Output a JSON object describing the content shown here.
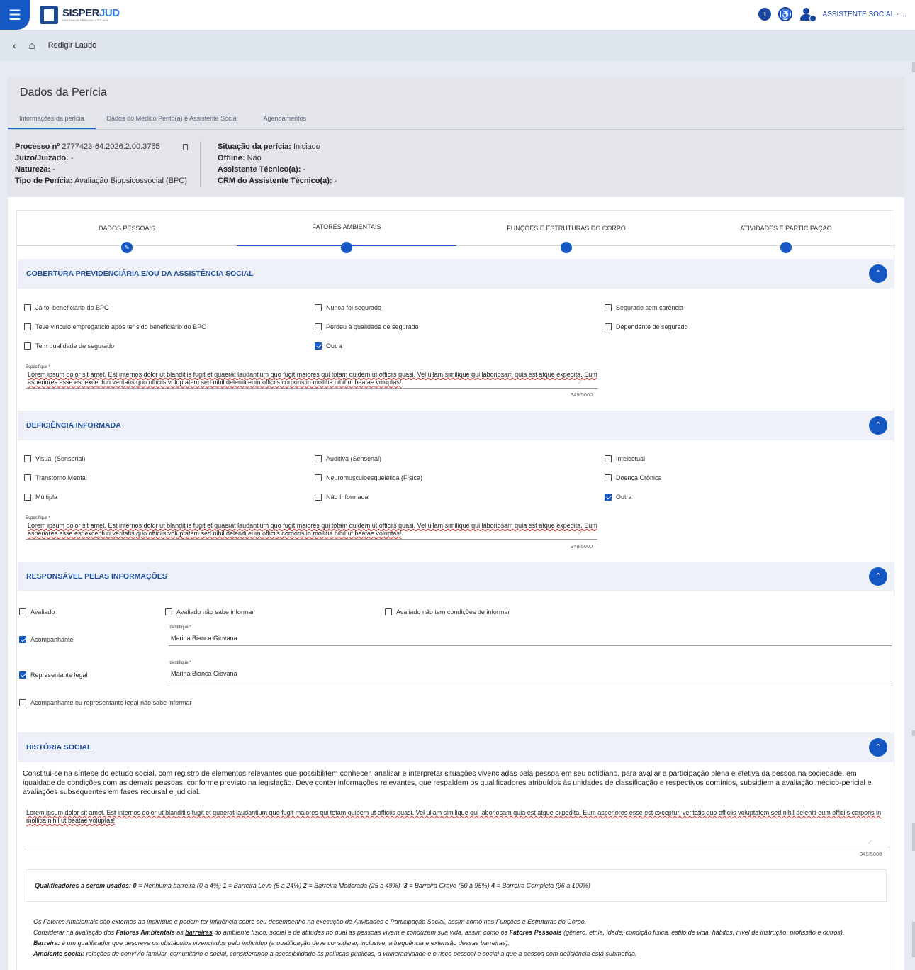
{
  "topbar": {
    "logo_main": "SISPER",
    "logo_accent": "JUD",
    "logo_sub": "SISTEMA DE PERÍCIAS JUDICIAIS",
    "user_name": "ASSISTENTE SOCIAL - ..."
  },
  "breadcrumb": {
    "current": "Redigir Laudo"
  },
  "card": {
    "title": "Dados da Perícia",
    "tabs": [
      "Informações da perícia",
      "Dados do Médico Perito(a) e Assistente Social",
      "Agendamentos"
    ],
    "info_left": [
      {
        "label": "Processo nº",
        "value": "2777423-64.2026.2.00.3755"
      },
      {
        "label": "Juízo/Juizado:",
        "value": "-"
      },
      {
        "label": "Natureza:",
        "value": "-"
      },
      {
        "label": "Tipo de Perícia:",
        "value": "Avaliação Biopsicossocial (BPC)"
      }
    ],
    "info_right": [
      {
        "label": "Situação da perícia:",
        "value": "Iniciado"
      },
      {
        "label": "Offline:",
        "value": "Não"
      },
      {
        "label": "Assistente Técnico(a):",
        "value": "-"
      },
      {
        "label": "CRM do Assistente Técnico(a):",
        "value": "-"
      }
    ]
  },
  "stepper": {
    "steps": [
      "DADOS PESSOAIS",
      "FATORES AMBIENTAIS",
      "FUNÇÕES E ESTRUTURAS DO CORPO",
      "ATIVIDADES E PARTICIPAÇÃO"
    ],
    "active_index": 1
  },
  "cobertura": {
    "title": "COBERTURA PREVIDENCIÁRIA E/OU DA ASSISTÊNCIA SOCIAL",
    "options": [
      {
        "label": "Já foi beneficiário do BPC",
        "checked": false
      },
      {
        "label": "Nunca foi segurado",
        "checked": false
      },
      {
        "label": "Segurado sem carência",
        "checked": false
      },
      {
        "label": "Teve vínculo empregatício após ter sido beneficiário do BPC",
        "checked": false
      },
      {
        "label": "Perdeu a qualidade de segurado",
        "checked": false
      },
      {
        "label": "Dependente de segurado",
        "checked": false
      },
      {
        "label": "Tem qualidade de segurado",
        "checked": false
      },
      {
        "label": "Outra",
        "checked": true
      }
    ],
    "field_label": "Especifique *",
    "field_value": "Lorem ipsum dolor sit amet. Est internos dolor ut blanditiis fugit et quaerat laudantium quo fugit maiores qui totam quidem ut officiis quasi. Vel ullam similique qui laboriosam quia est atque expedita. Eum asperiores esse est excepturi veritatis quo officiis voluptatem sed nihil deleniti eum officiis corporis in mollitia nihil ut beatae voluptas!",
    "counter": "349/5000"
  },
  "deficiencia": {
    "title": "DEFICIÊNCIA INFORMADA",
    "options": [
      {
        "label": "Visual (Sensorial)",
        "checked": false
      },
      {
        "label": "Auditiva (Sensorial)",
        "checked": false
      },
      {
        "label": "Intelectual",
        "checked": false
      },
      {
        "label": "Transtorno Mental",
        "checked": false
      },
      {
        "label": "Neuromusculoesquelética (Física)",
        "checked": false
      },
      {
        "label": "Doença Crônica",
        "checked": false
      },
      {
        "label": "Múltipla",
        "checked": false
      },
      {
        "label": "Não Informada",
        "checked": false
      },
      {
        "label": "Outra",
        "checked": true
      }
    ],
    "field_label": "Especifique *",
    "field_value": "Lorem ipsum dolor sit amet. Est internos dolor ut blanditiis fugit et quaerat laudantium quo fugit maiores qui totam quidem ut officiis quasi. Vel ullam similique qui laboriosam quia est atque expedita. Eum asperiores esse est excepturi veritatis quo officiis voluptatem sed nihil deleniti eum officiis corporis in mollitia nihil ut beatae voluptas!",
    "counter": "349/5000"
  },
  "responsavel": {
    "title": "RESPONSÁVEL PELAS INFORMAÇÕES",
    "avaliado": "Avaliado",
    "nao_sabe": "Avaliado não sabe informar",
    "sem_condicoes": "Avaliado não tem condições de informar",
    "acompanhante": "Acompanhante",
    "representante": "Representante legal",
    "nao_sabe_acomp": "Acompanhante ou representante legal não sabe informar",
    "identifique_label": "Identifique *",
    "acompanhante_value": "Marina Bianca Giovana",
    "representante_value": "Marina Bianca Giovana"
  },
  "historia": {
    "title": "HISTÓRIA SOCIAL",
    "description": "Constitui-se na síntese do estudo social, com registro de elementos relevantes que possibilitem conhecer, analisar e interpretar situações vivenciadas pela pessoa em seu cotidiano, para avaliar a participação plena e efetiva da pessoa na sociedade, em igualdade de condições com as demais pessoas, conforme previsto na legislação. Deve conter informações relevantes, que respaldem os qualificadores atribuídos às unidades de classificação e respectivos domínios, subsidiem a avaliação médico-pericial e avaliações subsequentes em fases recursal e judicial.",
    "field_value": "Lorem ipsum dolor sit amet. Est internos dolor ut blanditiis fugit et quaerat laudantium quo fugit maiores qui totam quidem ut officiis quasi. Vel ullam similique qui laboriosam quia est atque expedita. Eum asperiores esse est excepturi veritatis quo officiis voluptatem sed nihil deleniti eum officiis corporis in mollitia nihil ut beatae voluptas!",
    "counter": "349/5000"
  },
  "qualificadores": {
    "lead": "Qualificadores a serem usados:",
    "items": [
      {
        "num": "0",
        "text": "Nenhuma barreira (0 a 4%)"
      },
      {
        "num": "1",
        "text": "Barreira Leve (5 a 24%)"
      },
      {
        "num": "2",
        "text": "Barreira Moderada (25 a 49%)"
      },
      {
        "num": "3",
        "text": "Barreira Grave (50 a 95%)"
      },
      {
        "num": "4",
        "text": "Barreira Completa (96 a 100%)"
      }
    ]
  },
  "notes": {
    "line1": "Os Fatores Ambientais são externos ao indivíduo e podem ter influência sobre seu desempenho na execução de Atividades e Participação Social, assim como nas Funções e Estruturas do Corpo.",
    "line2_a": "Considerar na avaliação dos ",
    "line2_b": "Fatores Ambientais",
    "line2_c": " as ",
    "line2_d": "barreiras",
    "line2_e": " do ambiente físico, social e de atitudes no qual as pessoas vivem e conduzem sua vida, assim como os ",
    "line2_f": "Fatores Pessoais",
    "line2_g": " (gênero, etnia, idade, condição física, estilo de vida, hábitos, nível de instrução, profissão e outros).",
    "barreira_label": "Barreira:",
    "barreira_text": " é um qualificador que descreve os obstáculos vivenciados pelo indivíduo (a qualificação deve considerar, inclusive, a frequência e extensão dessas barreiras).",
    "ambiente_label": "Ambiente social:",
    "ambiente_text": " relações de convívio familiar, comunitário e social, considerando a acessibilidade às políticas públicas, a vulnerabilidade e o risco pessoal e social a que a pessoa com deficiência está submetida."
  }
}
